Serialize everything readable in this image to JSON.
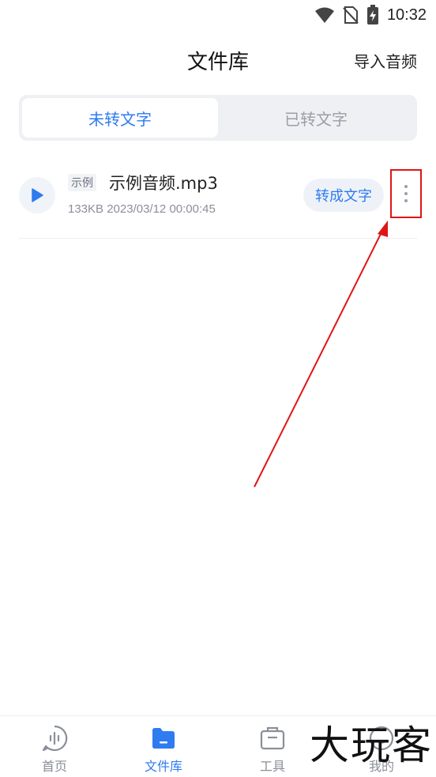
{
  "status_bar": {
    "time": "10:32"
  },
  "header": {
    "title": "文件库",
    "import_label": "导入音频"
  },
  "tabs": [
    {
      "label": "未转文字",
      "active": true
    },
    {
      "label": "已转文字",
      "active": false
    }
  ],
  "files": [
    {
      "badge": "示例",
      "name": "示例音频.mp3",
      "size": "133KB",
      "datetime": "2023/03/12 00:00:45",
      "meta": "133KB 2023/03/12 00:00:45",
      "convert_label": "转成文字"
    }
  ],
  "bottom_nav": [
    {
      "label": "首页",
      "icon": "voice-wave-icon",
      "active": false
    },
    {
      "label": "文件库",
      "icon": "folder-icon",
      "active": true
    },
    {
      "label": "工具",
      "icon": "toolbox-icon",
      "active": false
    },
    {
      "label": "我的",
      "icon": "profile-icon",
      "active": false
    }
  ],
  "watermark": "大玩客",
  "colors": {
    "accent": "#2f7bf0",
    "annotation": "#e01515"
  }
}
